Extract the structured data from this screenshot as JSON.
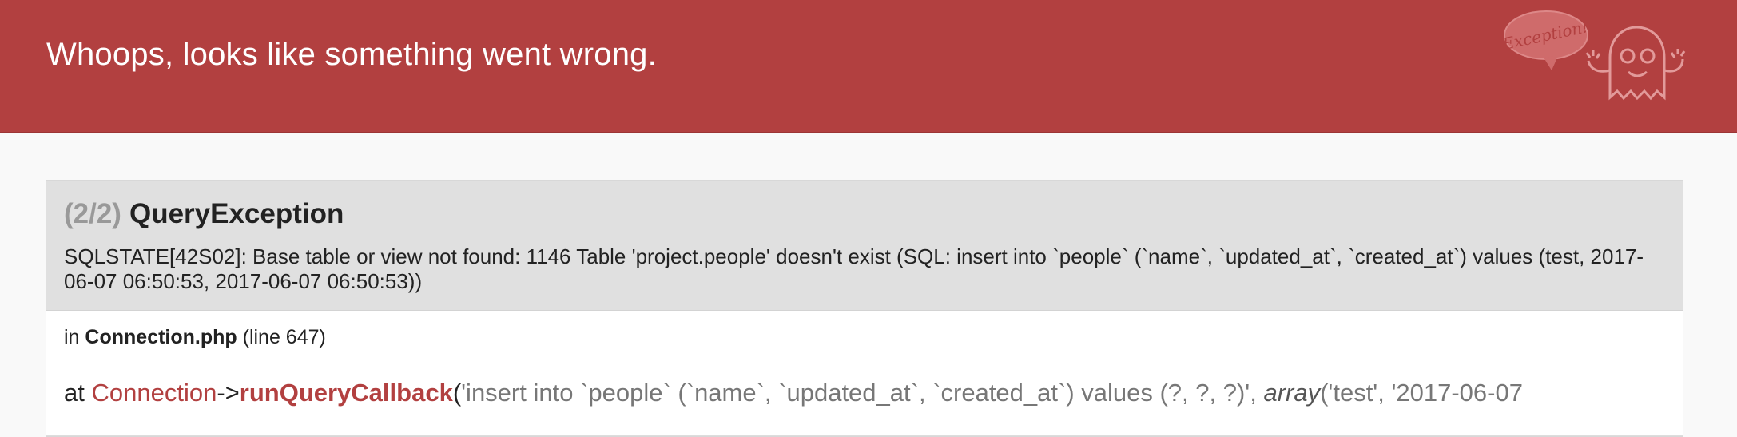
{
  "header": {
    "title": "Whoops, looks like something went wrong.",
    "mascot_text": "Exception!"
  },
  "exception": {
    "count": "(2/2)",
    "name": "QueryException",
    "message": "SQLSTATE[42S02]: Base table or view not found: 1146 Table 'project.people' doesn't exist (SQL: insert into `people` (`name`, `updated_at`, `created_at`) values (test, 2017-06-07 06:50:53, 2017-06-07 06:50:53))",
    "location_prefix": "in",
    "file": "Connection.php",
    "line_text": "(line 647)"
  },
  "trace": {
    "prefix": "at",
    "class": "Connection",
    "arrow": "->",
    "method": "runQueryCallback",
    "open_paren": "(",
    "arg1": "'insert into `people` (`name`, `updated_at`, `created_at`) values (?, ?, ?)', ",
    "arr_word": "array",
    "arr_rest": "('test', '2017-06-07"
  },
  "colors": {
    "header_bg": "#b24040",
    "accent": "#b24040",
    "card_head_bg": "#e0e0e0"
  }
}
